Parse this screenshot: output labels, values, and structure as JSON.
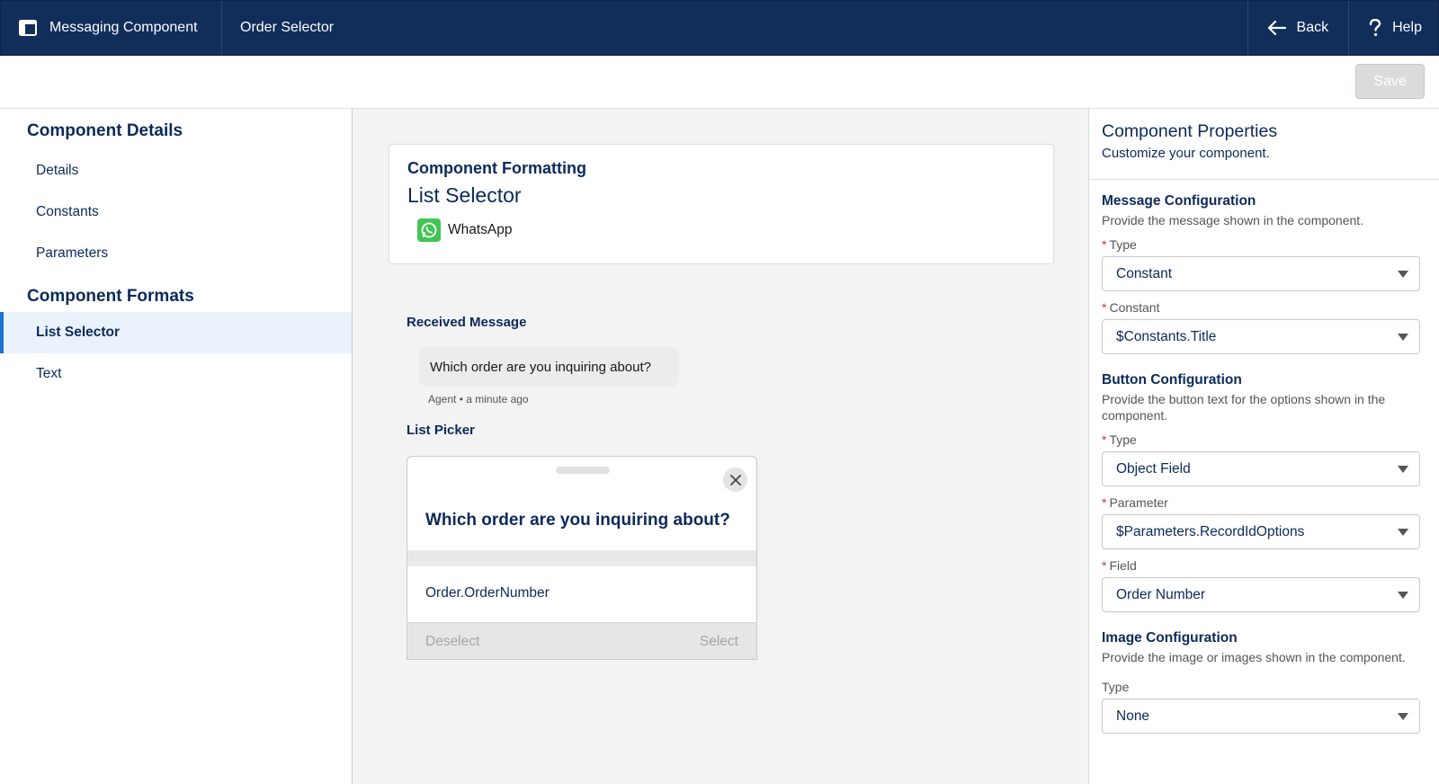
{
  "header": {
    "app_name": "Messaging Component",
    "tab": "Order Selector",
    "back_label": "Back",
    "help_label": "Help"
  },
  "toolbar": {
    "save_label": "Save"
  },
  "left": {
    "details_heading": "Component Details",
    "details_items": [
      "Details",
      "Constants",
      "Parameters"
    ],
    "formats_heading": "Component Formats",
    "format_items": [
      "List Selector",
      "Text"
    ]
  },
  "center": {
    "card_title": "Component Formatting",
    "card_subtitle": "List Selector",
    "channel": "WhatsApp",
    "received_label": "Received Message",
    "message": "Which order are you inquiring about?",
    "meta": "Agent • a minute ago",
    "picker_label": "List Picker",
    "picker_question": "Which order are you inquiring about?",
    "picker_option": "Order.OrderNumber",
    "deselect_label": "Deselect",
    "select_label": "Select"
  },
  "right": {
    "title": "Component Properties",
    "subtitle": "Customize your component.",
    "message_config": {
      "title": "Message Configuration",
      "desc": "Provide the message shown in the component.",
      "type_label": "Type",
      "type_value": "Constant",
      "constant_label": "Constant",
      "constant_value": "$Constants.Title"
    },
    "button_config": {
      "title": "Button Configuration",
      "desc": "Provide the button text for the options shown in the component.",
      "type_label": "Type",
      "type_value": "Object Field",
      "parameter_label": "Parameter",
      "parameter_value": "$Parameters.RecordIdOptions",
      "field_label": "Field",
      "field_value": "Order Number"
    },
    "image_config": {
      "title": "Image Configuration",
      "desc": "Provide the image or images shown in the component.",
      "type_label": "Type",
      "type_value": "None"
    }
  },
  "colors": {
    "header_bg": "#112e5b",
    "accent": "#1b74d4",
    "whatsapp": "#43c553",
    "required": "#c23934"
  }
}
